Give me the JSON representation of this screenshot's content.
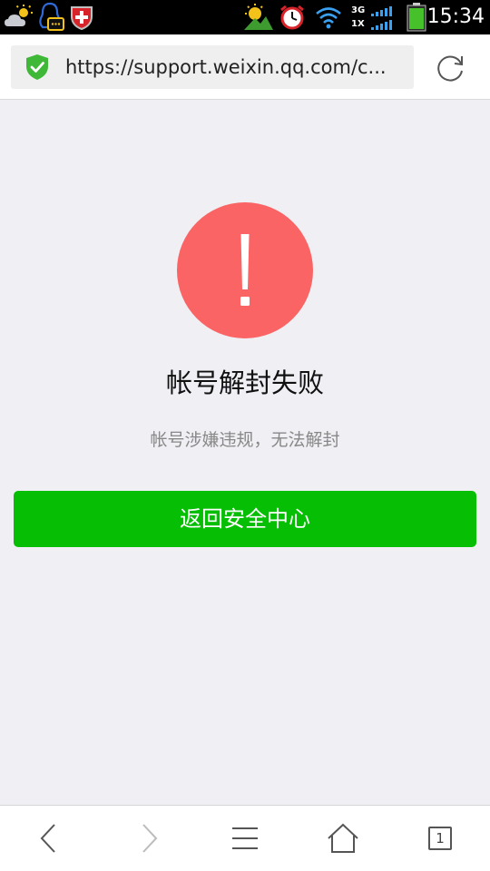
{
  "status_bar": {
    "time": "15:34",
    "network_top": "3G",
    "network_bottom": "1X",
    "icons": [
      "weather-icon",
      "qq-message-icon",
      "security-shield-icon",
      "sun-mountain-icon",
      "alarm-clock-icon",
      "wifi-icon",
      "signal-icon",
      "battery-icon"
    ]
  },
  "browser": {
    "url": "https://support.weixin.qq.com/c...",
    "security_icon": "shield-check-icon",
    "reload_icon": "reload-icon"
  },
  "main": {
    "alert_icon": "exclamation-icon",
    "title": "帐号解封失败",
    "description": "帐号涉嫌违规，无法解封",
    "button_label": "返回安全中心"
  },
  "toolbar": {
    "items": [
      "back-icon",
      "forward-icon",
      "menu-icon",
      "home-icon",
      "tabs-icon"
    ],
    "tab_count": "1"
  },
  "colors": {
    "alert_red": "#fa6464",
    "button_green": "#06be04",
    "shield_green": "#3fb837",
    "page_background": "#efeff4"
  }
}
